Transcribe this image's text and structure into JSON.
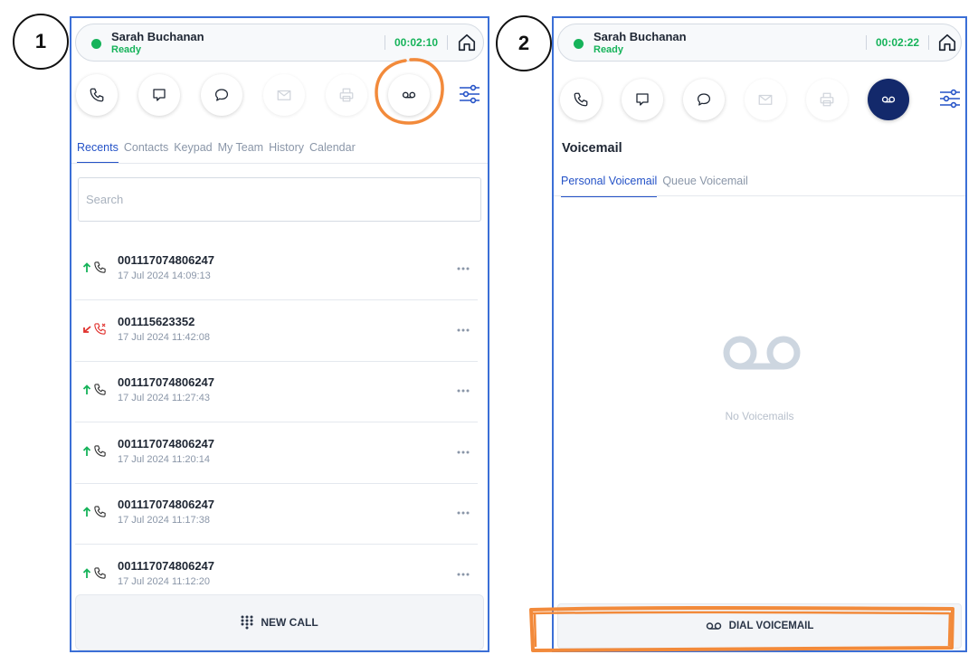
{
  "steps": [
    "1",
    "2"
  ],
  "colors": {
    "accent": "#2452c7",
    "ready": "#16b35a",
    "panel_border": "#3b6fd6",
    "active_button": "#13296b",
    "annotation": "#f28a3b",
    "missed": "#e0312d"
  },
  "panel1": {
    "agent": {
      "name": "Sarah Buchanan",
      "status": "Ready",
      "timer": "00:02:10"
    },
    "toolbar": [
      "phone-icon",
      "message-square-icon",
      "chat-bubble-icon",
      "mail-icon",
      "printer-icon",
      "voicemail-icon",
      "settings-sliders-icon"
    ],
    "tabs": [
      "Recents",
      "Contacts",
      "Keypad",
      "My Team",
      "History",
      "Calendar"
    ],
    "active_tab": "Recents",
    "search_placeholder": "Search",
    "calls": [
      {
        "number": "001117074806247",
        "time": "17 Jul 2024 14:09:13",
        "direction": "outgoing"
      },
      {
        "number": "001115623352",
        "time": "17 Jul 2024 11:42:08",
        "direction": "missed"
      },
      {
        "number": "001117074806247",
        "time": "17 Jul 2024 11:27:43",
        "direction": "outgoing"
      },
      {
        "number": "001117074806247",
        "time": "17 Jul 2024 11:20:14",
        "direction": "outgoing"
      },
      {
        "number": "001117074806247",
        "time": "17 Jul 2024 11:17:38",
        "direction": "outgoing"
      },
      {
        "number": "001117074806247",
        "time": "17 Jul 2024 11:12:20",
        "direction": "outgoing"
      }
    ],
    "new_call_label": "NEW CALL"
  },
  "panel2": {
    "agent": {
      "name": "Sarah Buchanan",
      "status": "Ready",
      "timer": "00:02:22"
    },
    "heading": "Voicemail",
    "tabs": [
      "Personal Voicemail",
      "Queue Voicemail"
    ],
    "active_tab": "Personal Voicemail",
    "empty_text": "No Voicemails",
    "dial_label": "DIAL VOICEMAIL"
  }
}
